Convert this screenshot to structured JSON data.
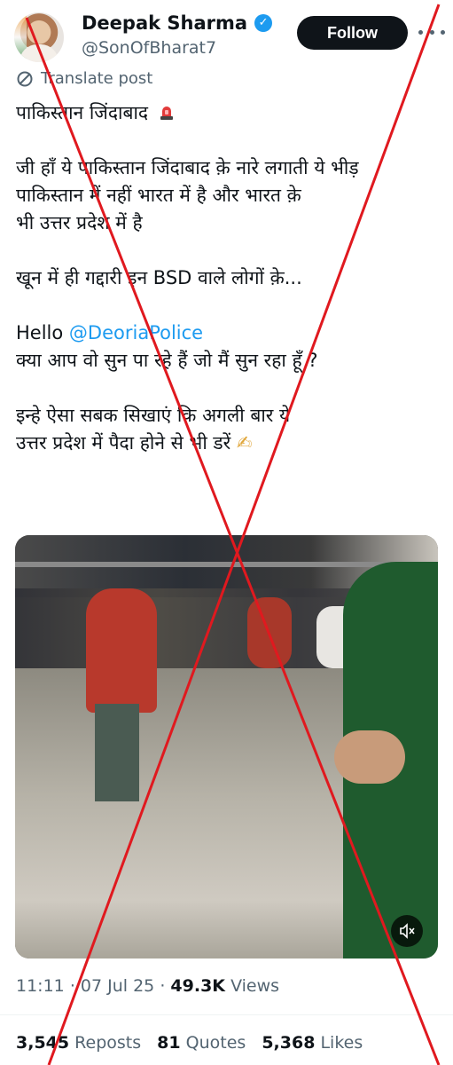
{
  "author": {
    "name": "Deepak Sharma",
    "handle": "@SonOfBharat7",
    "verified_badge": "✓",
    "follow_label": "Follow"
  },
  "translate_label": "Translate post",
  "tweet": {
    "line1": "पाकिस्तान जिंदाबाद",
    "para2_l1": "जी हाँ ये पाकिस्तान जिंदाबाद क़े नारे लगाती ये भीड़",
    "para2_l2": "पाकिस्तान में नहीं भारत में है और भारत क़े",
    "para2_l3": "भी उत्तर प्रदेश में है",
    "para3": "खून में ही गद्दारी इन BSD वाले लोगों क़े...",
    "hello": "Hello",
    "mention": "@DeoriaPolice",
    "para4_l2": "क्या आप वो सुन पा रहे हैं जो मैं सुन रहा हूँ ?",
    "para5_l1": "इन्हे ऐसा सबक सिखाएं कि अगली बार ये",
    "para5_l2": "उत्तर प्रदेश में पैदा होने से भी डरें",
    "emoji_writing": "✍"
  },
  "meta": {
    "time": "11:11",
    "sep": "·",
    "date": "07 Jul 25",
    "views_count": "49.3K",
    "views_label": "Views"
  },
  "stats": {
    "reposts_count": "3,545",
    "reposts_label": "Reposts",
    "quotes_count": "81",
    "quotes_label": "Quotes",
    "likes_count": "5,368",
    "likes_label": "Likes"
  },
  "colors": {
    "accent": "#1d9bf0",
    "cross_red": "#e0191f",
    "text_primary": "#0f1419",
    "text_secondary": "#536471"
  },
  "icons": [
    "verified-icon",
    "more-icon",
    "translate-icon",
    "siren-icon",
    "mute-icon"
  ]
}
